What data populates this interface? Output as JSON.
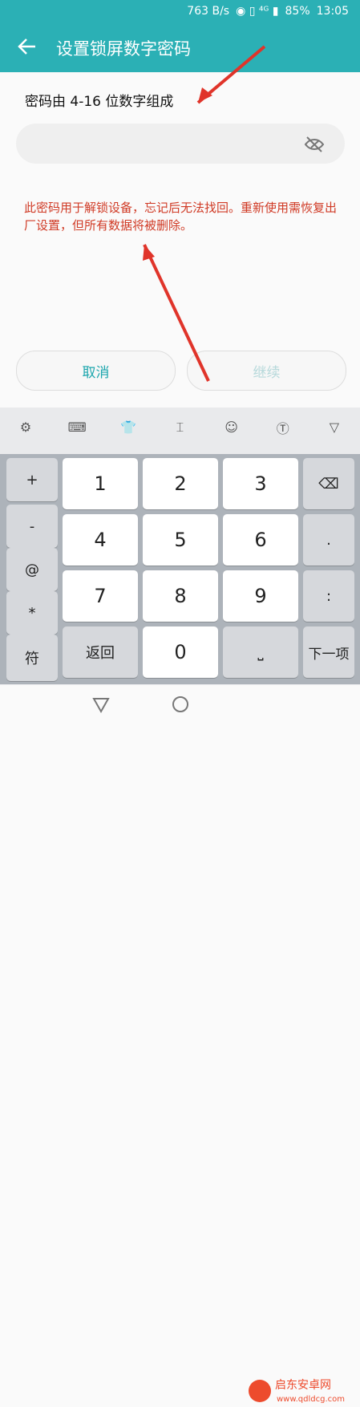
{
  "status": {
    "speed": "763 B/s",
    "battery": "85%",
    "time": "13:05"
  },
  "header": {
    "title": "设置锁屏数字密码"
  },
  "hint": "密码由 4-16 位数字组成",
  "warning": "此密码用于解锁设备，忘记后无法找回。重新使用需恢复出厂设置，但所有数据将被删除。",
  "buttons": {
    "cancel": "取消",
    "continue": "继续"
  },
  "keyboard": {
    "left": [
      "+",
      "-",
      "@",
      "*",
      "符"
    ],
    "numbers": [
      "1",
      "2",
      "3",
      "4",
      "5",
      "6",
      "7",
      "8",
      "9",
      "0"
    ],
    "right": [
      ".",
      ":",
      "下一项"
    ],
    "back": "返回"
  },
  "watermark": {
    "site": "启东安卓网",
    "url": "www.qdldcg.com"
  },
  "accent": "#2bb0b5"
}
